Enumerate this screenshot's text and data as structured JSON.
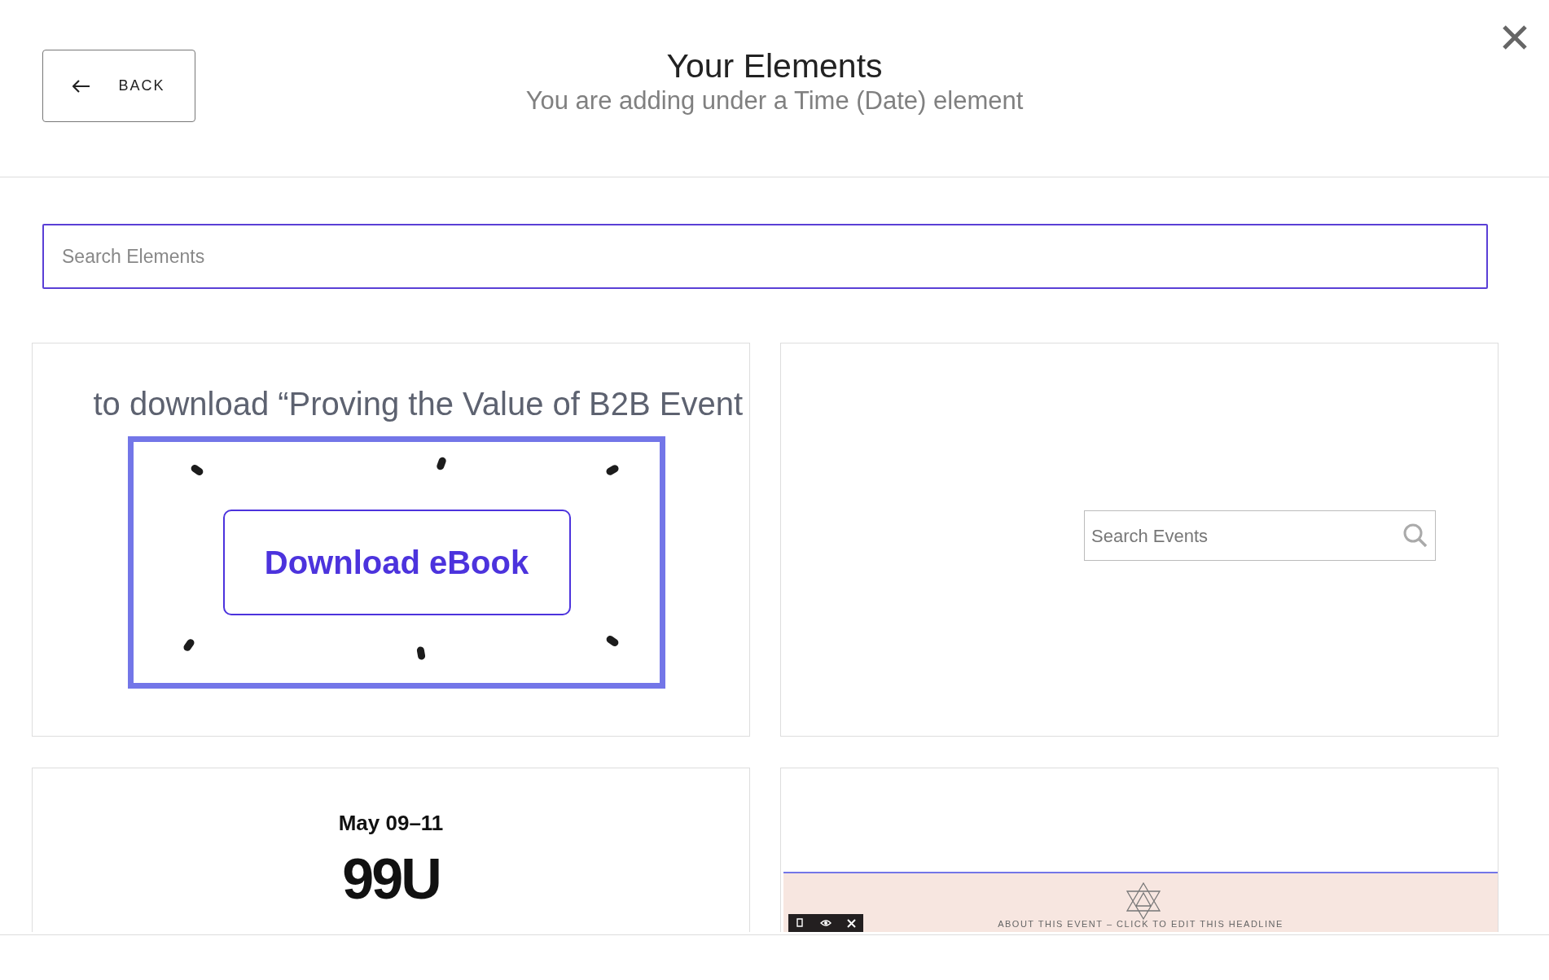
{
  "header": {
    "back_button": "BACK",
    "title": "Your Elements",
    "subtitle": "You are adding under a Time (Date) element"
  },
  "search": {
    "placeholder": "Search Elements"
  },
  "elements": [
    {
      "kind": "ebook",
      "headline": "to download “Proving the Value of B2B Event",
      "button": "Download eBook"
    },
    {
      "kind": "search",
      "placeholder": "Search Events"
    },
    {
      "kind": "date",
      "date": "May 09–11",
      "logo": "99U"
    },
    {
      "kind": "event",
      "headline": "ABOUT THIS EVENT – CLICK TO EDIT THIS HEADLINE"
    }
  ]
}
